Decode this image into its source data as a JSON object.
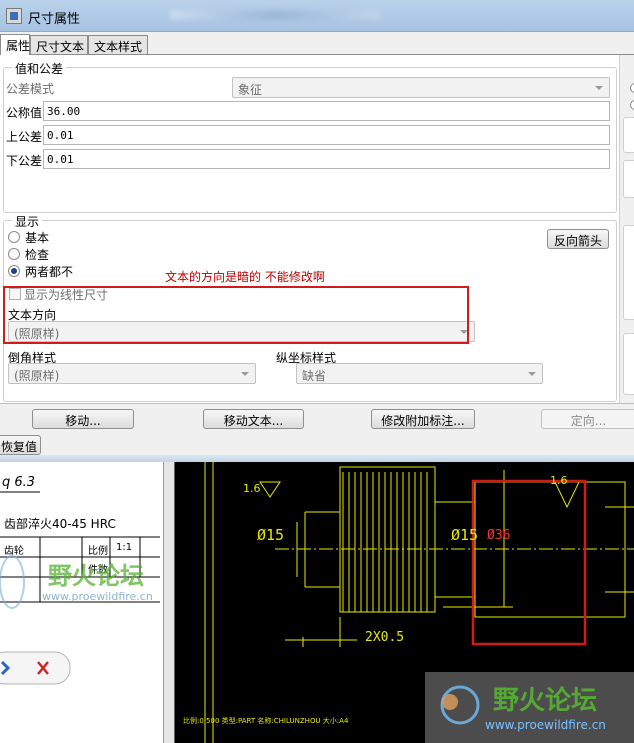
{
  "window": {
    "title": "尺寸属性"
  },
  "tabs": [
    {
      "label": "属性",
      "active": true
    },
    {
      "label": "尺寸文本",
      "active": false
    },
    {
      "label": "文本样式",
      "active": false
    }
  ],
  "value_tolerance": {
    "group_title": "值和公差",
    "tolerance_mode_label": "公差模式",
    "tolerance_mode_value": "象征",
    "nominal_label": "公称值",
    "nominal_value": "36.00",
    "upper_label": "上公差",
    "upper_value": "0.01",
    "lower_label": "下公差",
    "lower_value": "0.01"
  },
  "display": {
    "group_title": "显示",
    "radio_basic": "基本",
    "radio_inspect": "检查",
    "radio_neither": "两者都不",
    "selected": "两者都不",
    "reverse_arrow_button": "反向箭头",
    "linear_checkbox_label": "显示为线性尺寸",
    "text_direction_label": "文本方向",
    "text_direction_value": "(照原样)",
    "chamfer_label": "倒角样式",
    "chamfer_value": "(照原样)",
    "ordinate_label": "纵坐标样式",
    "ordinate_value": "缺省"
  },
  "annotation": {
    "text": "文本的方向是暗的  不能修改啊",
    "color": "#c00000"
  },
  "buttons": {
    "move": "移动...",
    "move_text": "移动文本...",
    "edit_attach": "修改附加标注...",
    "orient": "定向...",
    "restore": "恢复值"
  },
  "background": {
    "drawing_text_1": "q 6.3",
    "drawing_text_2": "齿部淬火40-45  HRC",
    "drawing_text_3": "齿轮",
    "drawing_text_4": "比例",
    "drawing_text_5": "1:1",
    "drawing_text_6": "件数",
    "watermark_cn": "野火论坛",
    "watermark_url": "www.proewildfire.cn",
    "cad_dim_1": "Ø15",
    "cad_dim_2": "Ø15",
    "cad_dim_3": "Ø36",
    "cad_dim_4": "2X0.5",
    "cad_tol_1": "1.6",
    "cad_tol_2": "1.6",
    "status_line": "比例:0.500    类型:PART    名称:CHILUNZHOU    大小:A4"
  },
  "colors": {
    "cad_lines": "#e8e800",
    "annotation_red": "#d11b1b",
    "cad_bg": "#000000"
  }
}
